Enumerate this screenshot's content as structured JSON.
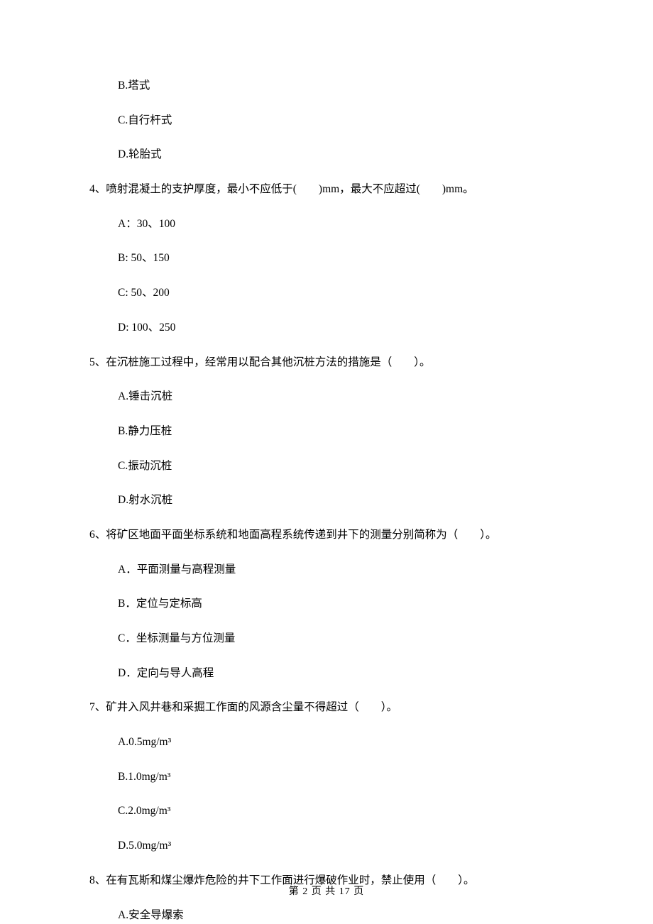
{
  "q3_remaining": {
    "optB": "B.塔式",
    "optC": "C.自行杆式",
    "optD": "D.轮胎式"
  },
  "q4": {
    "text": "4、喷射混凝土的支护厚度，最小不应低于(　　)mm，最大不应超过(　　)mm。",
    "optA": "A：30、100",
    "optB": "B: 50、150",
    "optC": "C: 50、200",
    "optD": "D: 100、250"
  },
  "q5": {
    "text": "5、在沉桩施工过程中，经常用以配合其他沉桩方法的措施是（　　）。",
    "optA": "A.锤击沉桩",
    "optB": "B.静力压桩",
    "optC": "C.振动沉桩",
    "optD": "D.射水沉桩"
  },
  "q6": {
    "text": "6、将矿区地面平面坐标系统和地面高程系统传递到井下的测量分别简称为（　　）。",
    "optA": "A．平面测量与高程测量",
    "optB": "B．定位与定标高",
    "optC": "C．坐标测量与方位测量",
    "optD": "D．定向与导人高程"
  },
  "q7": {
    "text": "7、矿井入风井巷和采掘工作面的风源含尘量不得超过（　　）。",
    "optA": "A.0.5mg/m³",
    "optB": "B.1.0mg/m³",
    "optC": "C.2.0mg/m³",
    "optD": "D.5.0mg/m³"
  },
  "q8": {
    "text": "8、在有瓦斯和煤尘爆炸危险的井下工作面进行爆破作业时，禁止使用（　　）。",
    "optA": "A.安全导爆索"
  },
  "footer": "第 2 页 共 17 页"
}
